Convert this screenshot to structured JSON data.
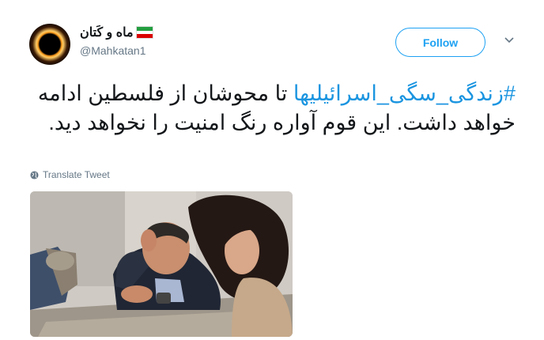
{
  "author": {
    "display_name": "ماه و کَتان",
    "handle": "@Mahkatan1",
    "flag_colors": [
      "#239f40",
      "#ffffff",
      "#da0000"
    ]
  },
  "actions": {
    "follow_label": "Follow",
    "more_icon": "chevron-down-icon"
  },
  "tweet": {
    "hashtag": "#زندگی_سگی_اسرائیلیها",
    "text": " تا محوشان از فلسطین ادامه خواهد داشت. این قوم آواره رنگ امنیت را نخواهد دید."
  },
  "translate": {
    "icon": "globe-icon",
    "label": "Translate Tweet"
  },
  "media": {
    "icon": "photo"
  },
  "colors": {
    "accent": "#1da1f2",
    "link": "#1b95e0",
    "secondary_text": "#657786"
  }
}
